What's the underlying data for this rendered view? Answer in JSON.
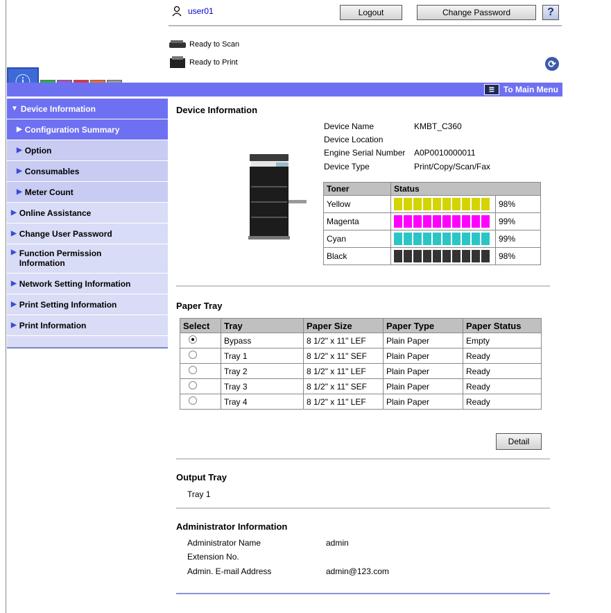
{
  "header": {
    "user": "user01",
    "logout": "Logout",
    "change_password": "Change Password",
    "help": "?",
    "scan_status": "Ready to Scan",
    "print_status": "Ready to Print"
  },
  "bar": {
    "main_menu": "To Main Menu"
  },
  "sidebar": {
    "items": [
      {
        "label": "Device Information"
      },
      {
        "label": "Configuration Summary"
      },
      {
        "label": "Option"
      },
      {
        "label": "Consumables"
      },
      {
        "label": "Meter Count"
      },
      {
        "label": "Online Assistance"
      },
      {
        "label": "Change User Password"
      },
      {
        "label": "Function Permission Information"
      },
      {
        "label": "Network Setting Information"
      },
      {
        "label": "Print Setting Information"
      },
      {
        "label": "Print Information"
      }
    ]
  },
  "device": {
    "heading": "Device Information",
    "name_label": "Device Name",
    "name_value": "KMBT_C360",
    "location_label": "Device Location",
    "serial_label": "Engine Serial Number",
    "serial_value": "A0P0010000011",
    "type_label": "Device Type",
    "type_value": "Print/Copy/Scan/Fax"
  },
  "toner": {
    "headers": [
      "Toner",
      "Status"
    ],
    "rows": [
      {
        "name": "Yellow",
        "pct": "98%",
        "level": 0.98,
        "color": "#d4d400"
      },
      {
        "name": "Magenta",
        "pct": "99%",
        "level": 0.99,
        "color": "#ff00ff"
      },
      {
        "name": "Cyan",
        "pct": "99%",
        "level": 0.99,
        "color": "#2ac6c6"
      },
      {
        "name": "Black",
        "pct": "98%",
        "level": 0.98,
        "color": "#333333"
      }
    ]
  },
  "paper_tray": {
    "heading": "Paper Tray",
    "headers": [
      "Select",
      "Tray",
      "Paper Size",
      "Paper Type",
      "Paper Status"
    ],
    "rows": [
      {
        "tray": "Bypass",
        "size": "8 1/2\" x 11\" LEF",
        "type": "Plain Paper",
        "status": "Empty",
        "selected": true
      },
      {
        "tray": "Tray 1",
        "size": "8 1/2\" x 11\" SEF",
        "type": "Plain Paper",
        "status": "Ready",
        "selected": false
      },
      {
        "tray": "Tray 2",
        "size": "8 1/2\" x 11\" LEF",
        "type": "Plain Paper",
        "status": "Ready",
        "selected": false
      },
      {
        "tray": "Tray 3",
        "size": "8 1/2\" x 11\" SEF",
        "type": "Plain Paper",
        "status": "Ready",
        "selected": false
      },
      {
        "tray": "Tray 4",
        "size": "8 1/2\" x 11\" LEF",
        "type": "Plain Paper",
        "status": "Ready",
        "selected": false
      }
    ],
    "detail_button": "Detail"
  },
  "output_tray": {
    "heading": "Output Tray",
    "value": "Tray 1"
  },
  "admin": {
    "heading": "Administrator Information",
    "name_label": "Administrator Name",
    "name_value": "admin",
    "ext_label": "Extension No.",
    "email_label": "Admin. E-mail Address",
    "email_value": "admin@123.com"
  }
}
